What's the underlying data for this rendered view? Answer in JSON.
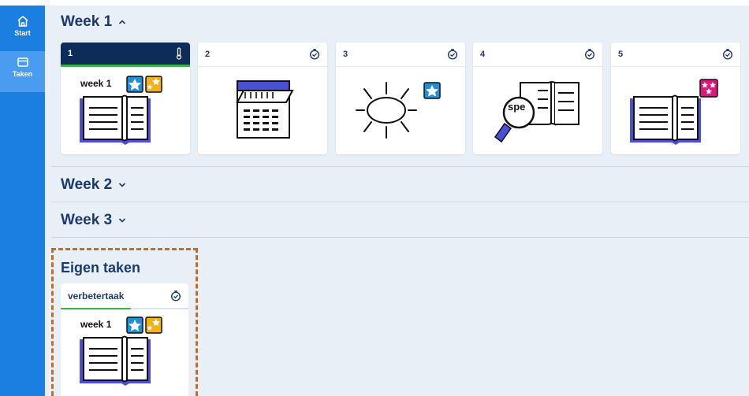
{
  "sidebar": {
    "items": [
      {
        "label": "Start",
        "icon": "home-icon"
      },
      {
        "label": "Taken",
        "icon": "tasks-icon"
      }
    ]
  },
  "weeks": [
    {
      "label": "Week 1",
      "chevron": "^",
      "expanded": true
    },
    {
      "label": "Week 2",
      "chevron": "v",
      "expanded": false
    },
    {
      "label": "Week 3",
      "chevron": "v",
      "expanded": false
    }
  ],
  "week1_cards": [
    {
      "number": "1",
      "status_icon": "thermometer-icon",
      "image": "book-week1-stars",
      "tag": "week 1"
    },
    {
      "number": "2",
      "status_icon": "timer-check-icon",
      "image": "calendar-icon"
    },
    {
      "number": "3",
      "status_icon": "timer-check-icon",
      "image": "sun-star"
    },
    {
      "number": "4",
      "status_icon": "timer-check-icon",
      "image": "magnifier-book",
      "tag": "spe"
    },
    {
      "number": "5",
      "status_icon": "timer-check-icon",
      "image": "book-pink-stars"
    }
  ],
  "eigen_taken": {
    "title": "Eigen taken",
    "card": {
      "label": "verbetertaak",
      "status_icon": "timer-check-icon",
      "tag": "week 1",
      "progress": 0.55
    }
  },
  "colors": {
    "sidebar": "#1a7fe0",
    "active_card_header": "#0d2c5a",
    "progress": "#38b34a",
    "highlight_border": "#c76b22",
    "star_blue": "#1f8fd8",
    "star_yellow": "#f3b21a",
    "star_pink": "#e0177a",
    "book_purple": "#4a4fd6"
  }
}
